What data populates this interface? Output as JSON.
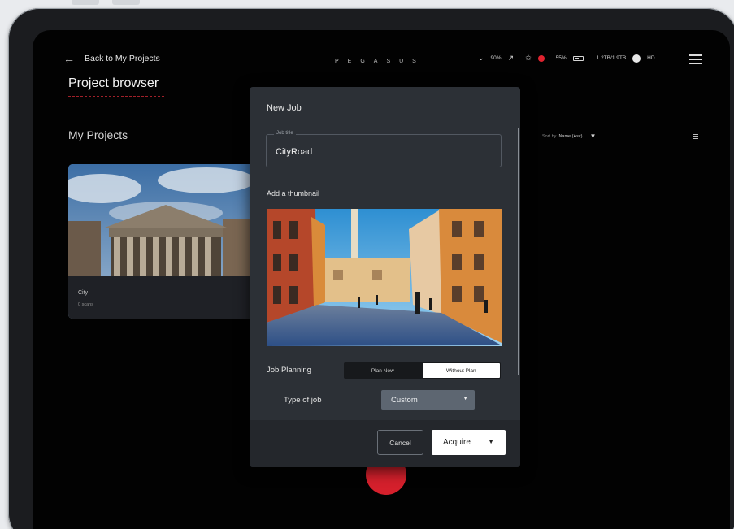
{
  "header": {
    "back_label": "Back to My Projects",
    "brand": "PEGASUS",
    "status": {
      "signal": "90%",
      "battery_pct": "55%",
      "storage": "1.2TB/1.9TB",
      "quality": "HD"
    }
  },
  "page": {
    "title": "Project browser",
    "section_title": "My Projects",
    "sort_prefix": "Sort by",
    "sort_value": "Name (Asc)"
  },
  "project_card": {
    "name": "City",
    "subtitle": "0 scans"
  },
  "modal": {
    "title": "New Job",
    "job_title_label": "Job title",
    "job_title_value": "CityRoad",
    "thumbnail_label": "Add a thumbnail",
    "planning_label": "Job Planning",
    "plan_options": [
      "Plan Now",
      "Without Plan"
    ],
    "plan_selected": "Without Plan",
    "type_label": "Type of job",
    "type_value": "Custom",
    "cancel_label": "Cancel",
    "acquire_label": "Acquire"
  },
  "icons": {
    "back": "arrow-left-icon",
    "menu": "hamburger-icon",
    "list_view": "list-icon",
    "dropdown": "chevron-down-icon"
  },
  "colors": {
    "accent": "#d5202c",
    "screen_bg": "#020202",
    "modal_bg": "#2c3036"
  }
}
